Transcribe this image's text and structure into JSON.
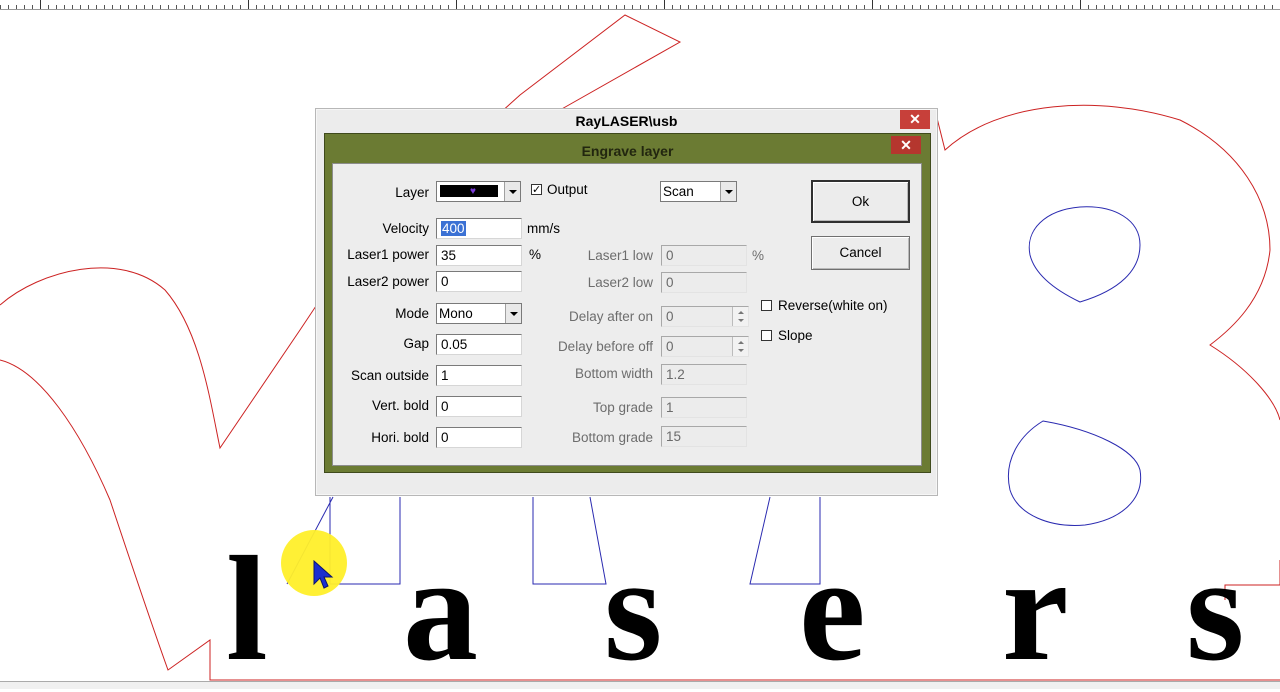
{
  "outer_dialog": {
    "title": "RayLASER\\usb",
    "close_glyph": "✕"
  },
  "dialog": {
    "title": "Engrave layer",
    "close_glyph": "✕",
    "labels": {
      "layer": "Layer",
      "velocity": "Velocity",
      "laser1_power": "Laser1 power",
      "laser2_power": "Laser2 power",
      "mode": "Mode",
      "gap": "Gap",
      "scan_outside": "Scan outside",
      "vert_bold": "Vert. bold",
      "hori_bold": "Hori. bold",
      "laser1_low": "Laser1 low",
      "laser2_low": "Laser2 low",
      "delay_after_on": "Delay after on",
      "delay_before_off": "Delay before off",
      "bottom_width": "Bottom width",
      "top_grade": "Top grade",
      "bottom_grade": "Bottom grade"
    },
    "units": {
      "velocity": "mm/s",
      "laser1_power": "%",
      "laser1_low": "%"
    },
    "values": {
      "velocity": "400",
      "laser1_power": "35",
      "laser2_power": "0",
      "mode": "Mono",
      "gap": "0.05",
      "scan_outside": "1",
      "vert_bold": "0",
      "hori_bold": "0",
      "laser1_low": "0",
      "laser2_low": "0",
      "delay_after_on": "0",
      "delay_before_off": "0",
      "bottom_width": "1.2",
      "top_grade": "1",
      "bottom_grade": "15",
      "scan_type": "Scan"
    },
    "output": {
      "label": "Output",
      "checked": true,
      "mark": "✓"
    },
    "reverse": {
      "label": "Reverse(white on)",
      "checked": false
    },
    "slope": {
      "label": "Slope",
      "checked": false
    },
    "buttons": {
      "ok": "Ok",
      "cancel": "Cancel"
    },
    "layer_color": "#000000"
  },
  "canvas": {
    "letters": [
      "l",
      "a",
      "s",
      "e",
      "r",
      "s"
    ],
    "outline_color_red": "#cc2222",
    "outline_color_blue": "#2a2ab0"
  },
  "cursor": {
    "halo_color": "#ffef2a"
  }
}
